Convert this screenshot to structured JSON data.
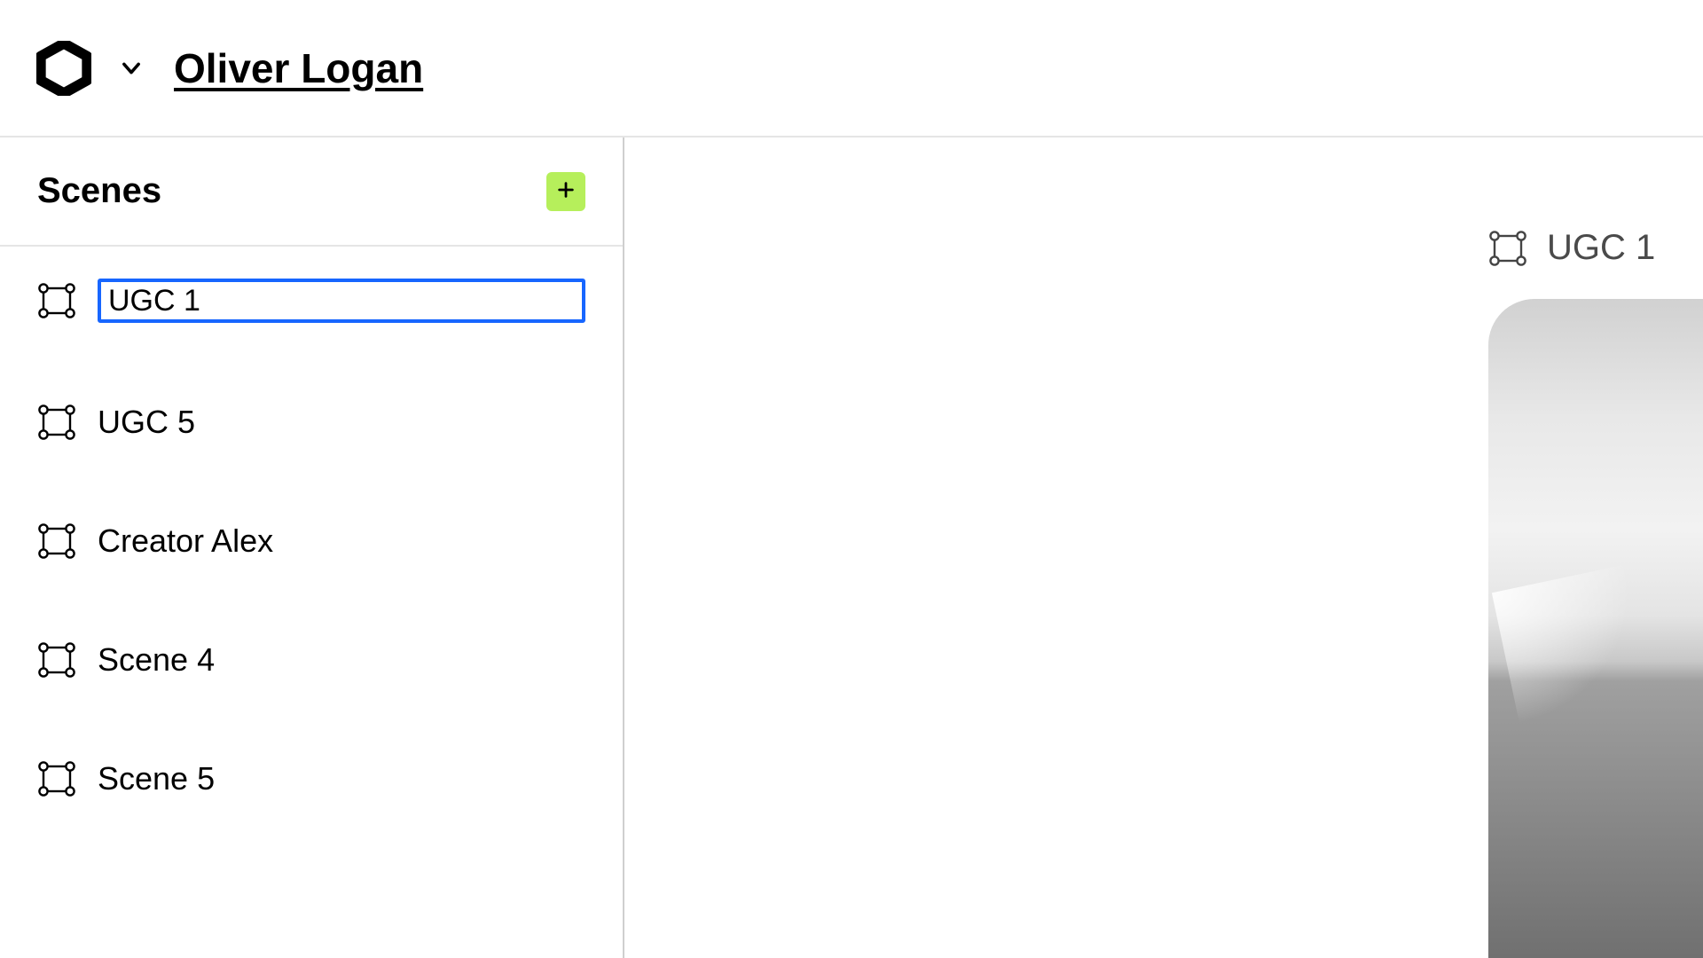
{
  "header": {
    "project_name": "Oliver Logan"
  },
  "sidebar": {
    "title": "Scenes",
    "items": [
      {
        "label": "UGC 1",
        "editing": true
      },
      {
        "label": "UGC 5",
        "editing": false
      },
      {
        "label": "Creator Alex",
        "editing": false
      },
      {
        "label": "Scene 4",
        "editing": false
      },
      {
        "label": "Scene 5",
        "editing": false
      }
    ]
  },
  "canvas": {
    "active_scene_label": "UGC 1"
  },
  "colors": {
    "accent_green": "#b6ef5b",
    "selection_blue": "#1766ff"
  }
}
